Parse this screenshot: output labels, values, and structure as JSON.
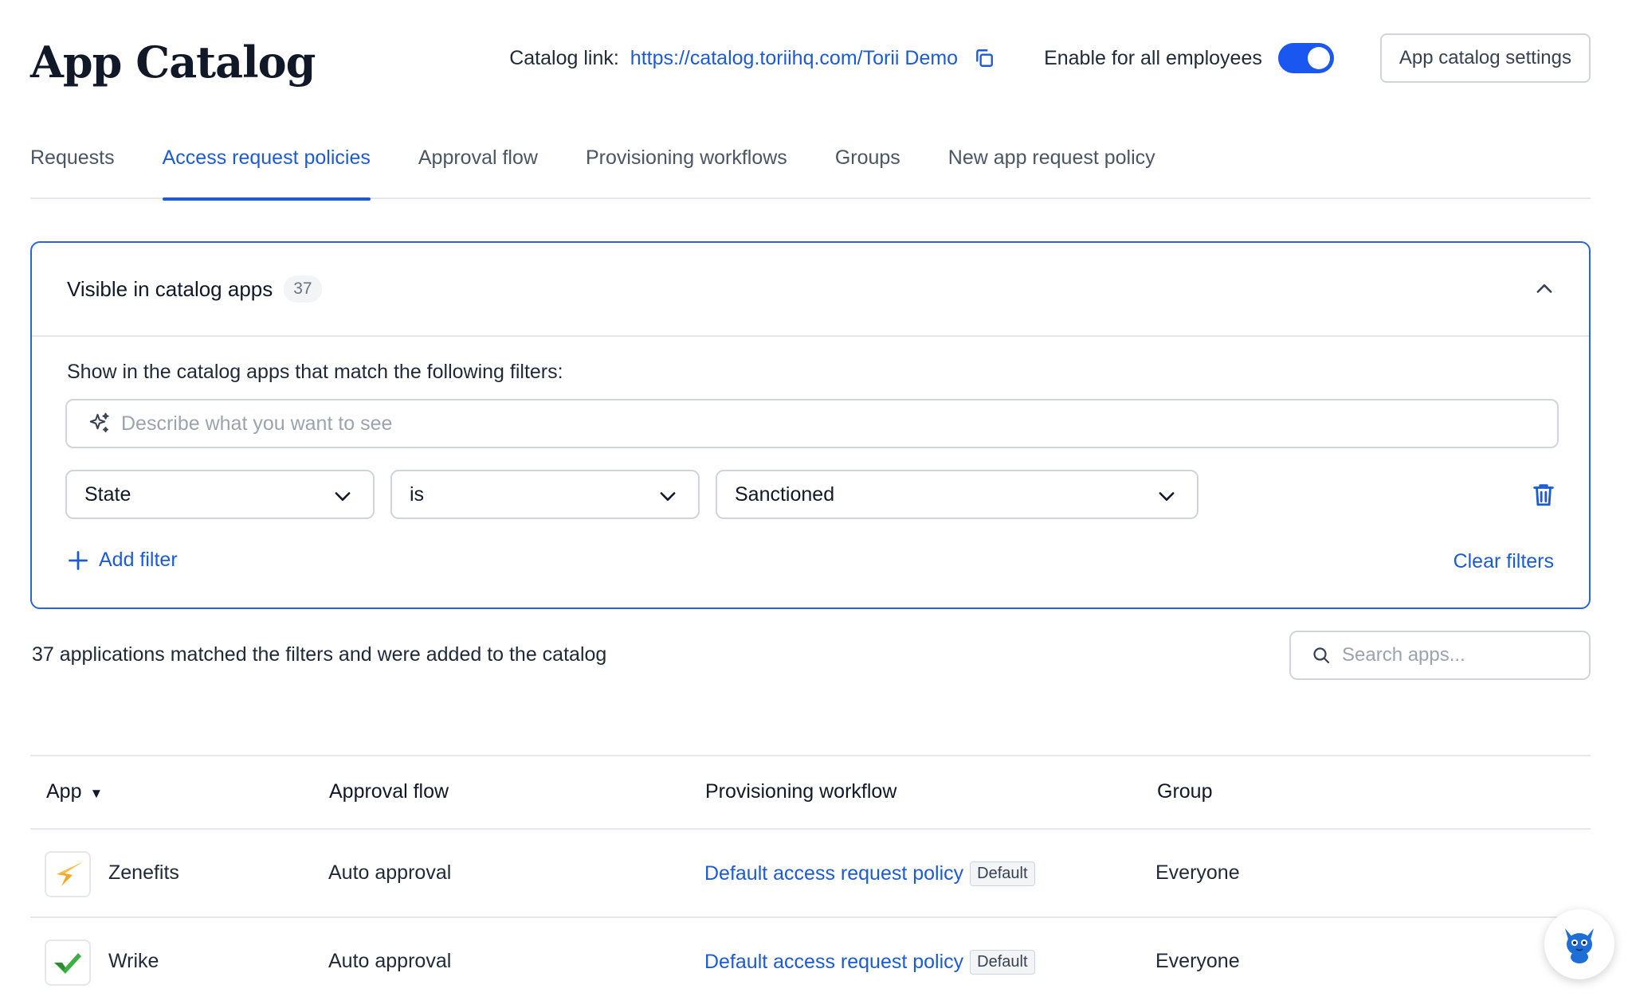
{
  "header": {
    "title": "App Catalog",
    "catalog_link_label": "Catalog link:",
    "catalog_link_url": "https://catalog.toriihq.com/Torii Demo",
    "enable_label": "Enable for all employees",
    "enable_toggle_on": true,
    "settings_button": "App catalog settings"
  },
  "tabs": [
    {
      "label": "Requests",
      "active": false
    },
    {
      "label": "Access request policies",
      "active": true
    },
    {
      "label": "Approval flow",
      "active": false
    },
    {
      "label": "Provisioning workflows",
      "active": false
    },
    {
      "label": "Groups",
      "active": false
    },
    {
      "label": "New app request policy",
      "active": false
    }
  ],
  "panel": {
    "title": "Visible in catalog apps",
    "count": "37",
    "filter_description": "Show in the catalog apps that match the following filters:",
    "ai_placeholder": "Describe what you want to see",
    "filter": {
      "field": "State",
      "operator": "is",
      "value": "Sanctioned"
    },
    "add_filter": "Add filter",
    "clear_filters": "Clear filters"
  },
  "results": {
    "matched_text": "37 applications matched the filters and were added to the catalog",
    "search_placeholder": "Search apps..."
  },
  "table": {
    "columns": {
      "app": "App",
      "approval_flow": "Approval flow",
      "provisioning_workflow": "Provisioning workflow",
      "group": "Group"
    },
    "rows": [
      {
        "app": "Zenefits",
        "logo": "zenefits-logo",
        "approval": "Auto approval",
        "workflow": "Default access request policy",
        "tag": "Default",
        "group": "Everyone"
      },
      {
        "app": "Wrike",
        "logo": "wrike-logo",
        "approval": "Auto approval",
        "workflow": "Default access request policy",
        "tag": "Default",
        "group": "Everyone"
      }
    ]
  },
  "colors": {
    "accent": "#1d5bd6",
    "toggle": "#1a56f0",
    "zenefits_logo": "#f5a623",
    "wrike_logo": "#3cb043"
  }
}
